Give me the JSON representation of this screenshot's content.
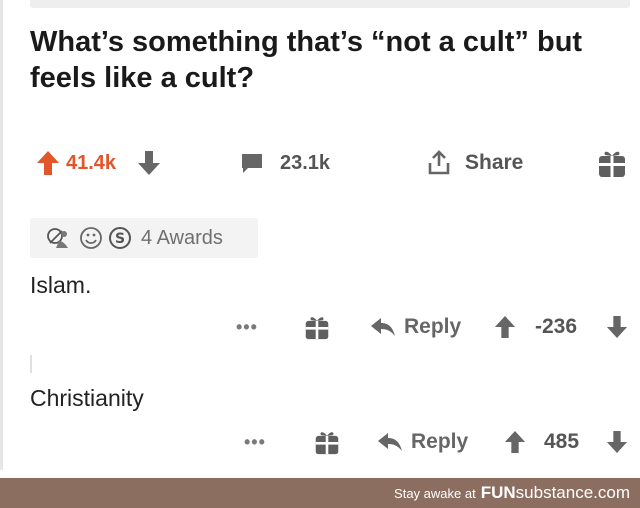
{
  "post": {
    "title": "What’s something that’s “not a cult” but feels like a cult?",
    "upvotes": "41.4k",
    "comments": "23.1k",
    "share_label": "Share"
  },
  "awards": {
    "label": "4 Awards"
  },
  "comments": [
    {
      "text": "Islam.",
      "reply_label": "Reply",
      "score": "-236"
    },
    {
      "text": "Christianity",
      "reply_label": "Reply",
      "score": "485"
    }
  ],
  "footer": {
    "tagline": "Stay awake at",
    "brand_bold": "FUN",
    "brand_rest": "substance.com"
  },
  "colors": {
    "upvote_orange": "#e2562a",
    "icon_gray": "#666666",
    "footer_bg": "#8b6e5f"
  },
  "icons": [
    "arrow-up-icon",
    "arrow-down-icon",
    "comment-icon",
    "share-icon",
    "gift-icon",
    "award-icon",
    "reply-icon",
    "more-icon"
  ]
}
